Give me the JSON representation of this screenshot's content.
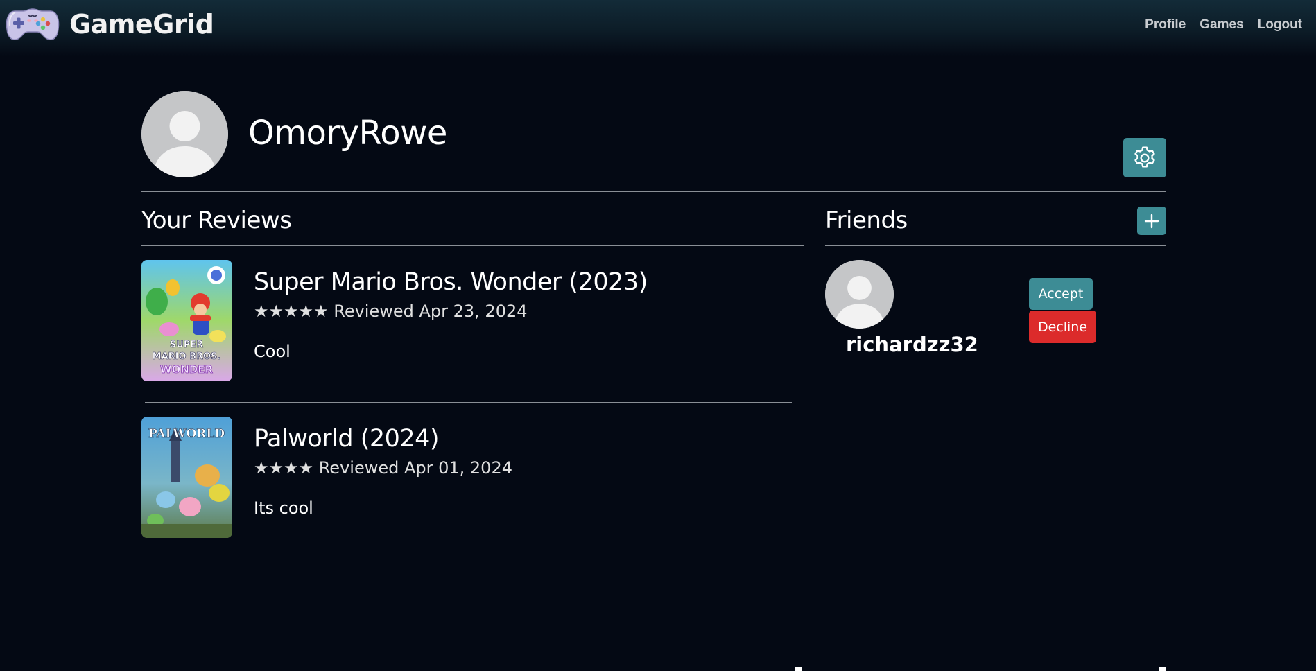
{
  "navbar": {
    "brand": "GameGrid",
    "links": [
      "Profile",
      "Games",
      "Logout"
    ]
  },
  "profile": {
    "username": "OmoryRowe"
  },
  "reviews": {
    "heading": "Your Reviews",
    "items": [
      {
        "title": "Super Mario Bros. Wonder (2023)",
        "stars": "★★★★★",
        "rating": 5,
        "date": "Reviewed Apr 23, 2024",
        "text": "Cool",
        "cover_text": [
          "SUPER",
          "MARIO BROS.",
          "WONDER"
        ]
      },
      {
        "title": "Palworld (2024)",
        "stars": "★★★★",
        "rating": 4,
        "date": "Reviewed Apr 01, 2024",
        "text": "Its cool",
        "cover_text": [
          "PALWORLD"
        ]
      }
    ]
  },
  "friends": {
    "heading": "Friends",
    "requests": [
      {
        "name": "richardzz32",
        "accept_label": "Accept",
        "decline_label": "Decline"
      }
    ]
  },
  "colors": {
    "background": "#040914",
    "accent": "#3d8c95",
    "danger": "#dc2b2b"
  },
  "icons": {
    "logo": "gamepad-icon",
    "settings": "gear-icon",
    "add_friend": "plus-icon",
    "avatar": "default-user-icon"
  }
}
